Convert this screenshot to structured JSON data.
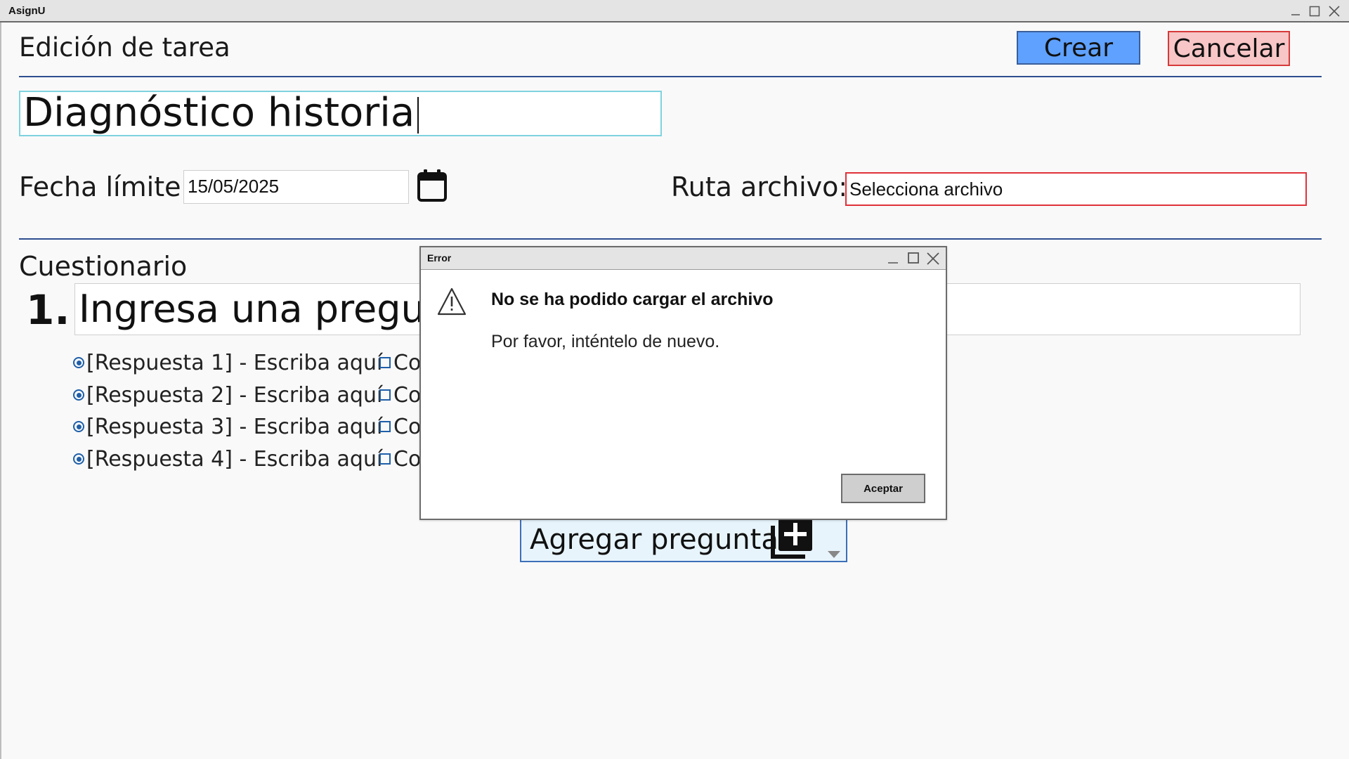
{
  "window": {
    "title": "AsignU",
    "minimize_icon": "minimize-icon",
    "maximize_icon": "maximize-icon",
    "close_icon": "close-icon"
  },
  "header": {
    "title": "Edición de tarea",
    "create_label": "Crear",
    "cancel_label": "Cancelar",
    "create_color": "#5fa1ff",
    "cancel_color": "#f8c6c6"
  },
  "task": {
    "name_value": "Diagnóstico historia",
    "deadline_label": "Fecha límite:",
    "deadline_value": "15/05/2025",
    "calendar_icon": "calendar-icon",
    "file_label": "Ruta archivo:",
    "file_value": "Selecciona archivo"
  },
  "questionnaire": {
    "title": "Cuestionario",
    "question_number": "1.",
    "question_placeholder": "Ingresa una pregunta",
    "answers": [
      "[Respuesta 1] - Escriba aquí",
      "[Respuesta 2] - Escriba aquí",
      "[Respuesta 3] - Escriba aquí",
      "[Respuesta 4] - Escriba aquí"
    ],
    "correct_label_visible": "Co",
    "add_question_label": "Agregar pregunta",
    "add_icon": "add-library-icon",
    "dropdown_icon": "caret-down-icon"
  },
  "dialog": {
    "title": "Error",
    "heading": "No se ha podido cargar el archivo",
    "message": "Por favor, inténtelo de nuevo.",
    "ok_label": "Aceptar",
    "warning_icon": "warning-icon"
  }
}
